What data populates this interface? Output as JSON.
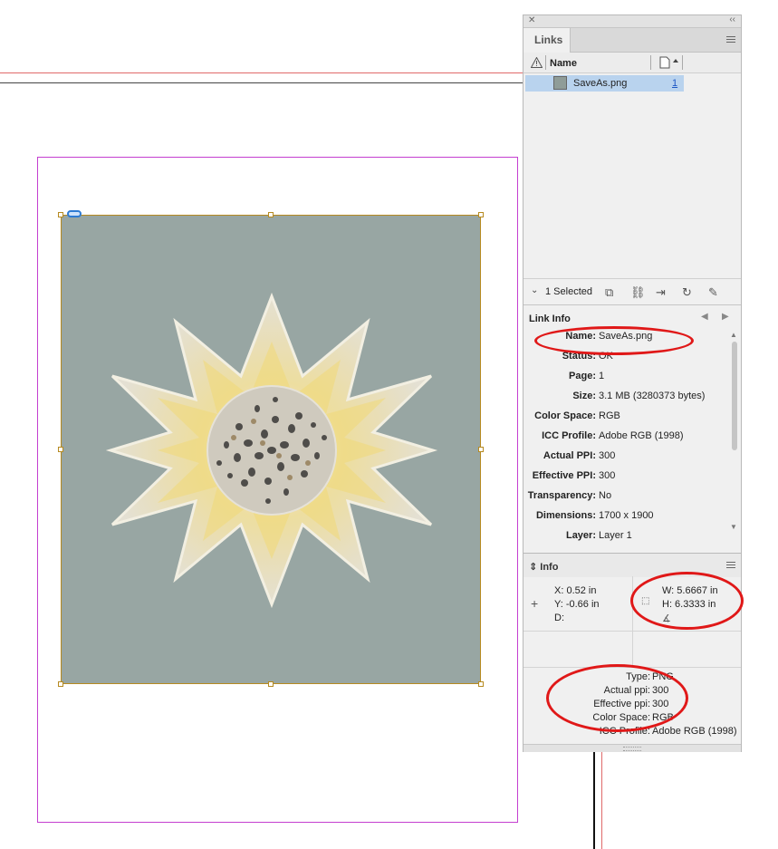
{
  "panel": {
    "tab": "Links",
    "columns": {
      "name": "Name"
    },
    "row": {
      "file": "SaveAs.png",
      "page": "1"
    },
    "selected_text": "1 Selected",
    "link_info_title": "Link Info",
    "link_info": [
      {
        "k": "Name:",
        "v": "SaveAs.png"
      },
      {
        "k": "Status:",
        "v": "OK"
      },
      {
        "k": "Page:",
        "v": "1"
      },
      {
        "k": "Size:",
        "v": "3.1 MB (3280373 bytes)"
      },
      {
        "k": "Color Space:",
        "v": "RGB"
      },
      {
        "k": "ICC Profile:",
        "v": "Adobe RGB (1998)"
      },
      {
        "k": "Actual PPI:",
        "v": "300"
      },
      {
        "k": "Effective PPI:",
        "v": "300"
      },
      {
        "k": "Transparency:",
        "v": "No"
      },
      {
        "k": "Dimensions:",
        "v": "1700 x 1900"
      },
      {
        "k": "Layer:",
        "v": "Layer 1"
      }
    ],
    "info_title": "Info",
    "info": {
      "x": "X: 0.52 in",
      "y": "Y: -0.66 in",
      "d": "D:",
      "w": "W: 5.6667 in",
      "h": "H: 6.3333 in"
    },
    "image_info": [
      {
        "k": "Type:",
        "v": "PNG"
      },
      {
        "k": "Actual ppi:",
        "v": "300"
      },
      {
        "k": "Effective ppi:",
        "v": "300"
      },
      {
        "k": "Color Space:",
        "v": "RGB"
      },
      {
        "k": "ICC Profile:",
        "v": "Adobe RGB (1998)"
      }
    ]
  },
  "colors": {
    "frame_fill": "#98a6a3",
    "frame_stroke": "#b68a20",
    "page_border": "#c43fd0",
    "annotation": "#e01818",
    "selection": "#b9d3ee"
  }
}
